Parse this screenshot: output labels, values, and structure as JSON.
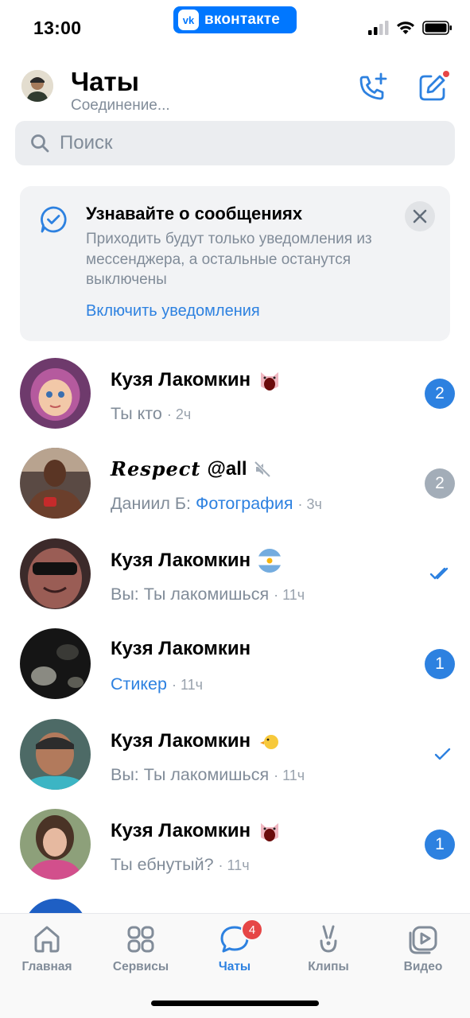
{
  "status_bar": {
    "time": "13:00",
    "vk_badge": "вконтакте",
    "vk_logo": "vk"
  },
  "header": {
    "title": "Чаты",
    "subtitle": "Соединение..."
  },
  "search": {
    "placeholder": "Поиск"
  },
  "banner": {
    "title": "Узнавайте о сообщениях",
    "text": "Приходить будут только уведомления из мессенджера, а остальные останутся выключены",
    "link": "Включить уведомления"
  },
  "chats": [
    {
      "name": "Кузя Лакомкин",
      "emoji": "pig",
      "preview": "Ты кто",
      "time": "2ч",
      "badge": "2",
      "status": "unread"
    },
    {
      "name": "Respect",
      "name_suffix": "@all",
      "muted": true,
      "sender": "Даниил Б:",
      "preview_link": "Фотография",
      "time": "3ч",
      "badge": "2",
      "status": "muted-unread"
    },
    {
      "name": "Кузя Лакомкин",
      "emoji": "flag-argentina",
      "sender": "Вы:",
      "preview": "Ты лакомишься",
      "time": "11ч",
      "status": "read"
    },
    {
      "name": "Кузя Лакомкин",
      "preview_link": "Стикер",
      "time": "11ч",
      "badge": "1",
      "status": "unread"
    },
    {
      "name": "Кузя Лакомкин",
      "emoji": "chick",
      "sender": "Вы:",
      "preview": "Ты лакомишься",
      "time": "11ч",
      "status": "sent"
    },
    {
      "name": "Кузя Лакомкин",
      "emoji": "pig",
      "preview": "Ты ебнутый?",
      "time": "11ч",
      "badge": "1",
      "status": "unread"
    }
  ],
  "tabbar": {
    "tabs": [
      {
        "label": "Главная",
        "icon": "home-icon"
      },
      {
        "label": "Сервисы",
        "icon": "services-icon"
      },
      {
        "label": "Чаты",
        "icon": "chat-icon",
        "badge": "4",
        "active": true
      },
      {
        "label": "Клипы",
        "icon": "clips-icon"
      },
      {
        "label": "Видео",
        "icon": "video-icon"
      }
    ]
  },
  "colors": {
    "accent": "#2d81e0",
    "vk_blue": "#0077ff",
    "secondary_text": "#818c99",
    "badge_red": "#e64646"
  }
}
